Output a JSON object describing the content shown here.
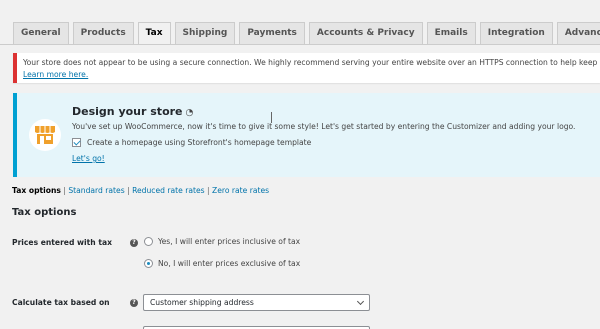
{
  "tabs": [
    {
      "label": "General",
      "active": false
    },
    {
      "label": "Products",
      "active": false
    },
    {
      "label": "Tax",
      "active": true
    },
    {
      "label": "Shipping",
      "active": false
    },
    {
      "label": "Payments",
      "active": false
    },
    {
      "label": "Accounts & Privacy",
      "active": false
    },
    {
      "label": "Emails",
      "active": false
    },
    {
      "label": "Integration",
      "active": false
    },
    {
      "label": "Advanced",
      "active": false
    }
  ],
  "notice_secure": {
    "text": "Your store does not appear to be using a secure connection. We highly recommend serving your entire website over an HTTPS connection to help keep customer data secure.",
    "link": "Learn more here."
  },
  "design_notice": {
    "title": "Design your store",
    "text": "You've set up WooCommerce, now it's time to give it some style! Let's get started by entering the Customizer and adding your logo.",
    "checkbox_label": "Create a homepage using Storefront's homepage template",
    "checkbox_checked": true,
    "link": "Let's go!"
  },
  "subnav": {
    "current": "Tax options",
    "links": [
      "Standard rates",
      "Reduced rate rates",
      "Zero rate rates"
    ]
  },
  "section_title": "Tax options",
  "prices_entered": {
    "label": "Prices entered with tax",
    "options": [
      {
        "label": "Yes, I will enter prices inclusive of tax",
        "selected": false
      },
      {
        "label": "No, I will enter prices exclusive of tax",
        "selected": true
      }
    ]
  },
  "calc_based_on": {
    "label": "Calculate tax based on",
    "value": "Customer shipping address"
  },
  "colors": {
    "accent": "#0073aa",
    "error_border": "#dc3232",
    "info_border": "#00a0d2",
    "store_icon": "#f0a02b"
  }
}
